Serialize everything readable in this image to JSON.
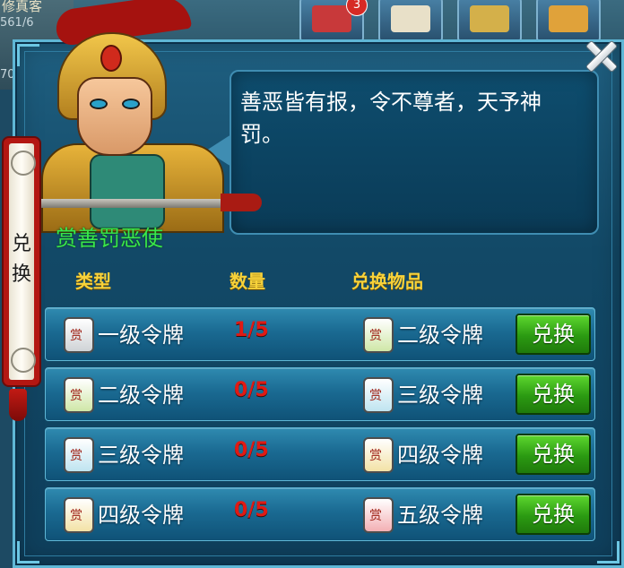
{
  "background": {
    "left_text_top": "修真客",
    "left_text_stat": "561/6",
    "left_text_num": "70",
    "badge_count": "3",
    "icon_labels": [
      "提升",
      "邮件",
      "",
      ""
    ]
  },
  "dialog": {
    "side_tab_label": [
      "兑",
      "换"
    ],
    "npc_name": "赏善罚恶使",
    "speech": "善恶皆有报，令不尊者，天予神罚。",
    "colors": {
      "name": "#39e84a",
      "header": "#f7d23a",
      "qty": "#e01a14",
      "button": "#2b9a12"
    }
  },
  "table": {
    "headers": {
      "type": "类型",
      "qty": "数量",
      "reward": "兑换物品"
    },
    "rows": [
      {
        "item": "一级令牌",
        "qty": "1/5",
        "reward": "二级令牌",
        "button": "兑换",
        "item_color": "#cfd3d6",
        "reward_color": "#cfe7a7"
      },
      {
        "item": "二级令牌",
        "qty": "0/5",
        "reward": "三级令牌",
        "button": "兑换",
        "item_color": "#cfe7a7",
        "reward_color": "#bfe4f0"
      },
      {
        "item": "三级令牌",
        "qty": "0/5",
        "reward": "四级令牌",
        "button": "兑换",
        "item_color": "#bfe4f0",
        "reward_color": "#f3e2a6"
      },
      {
        "item": "四级令牌",
        "qty": "0/5",
        "reward": "五级令牌",
        "button": "兑换",
        "item_color": "#f3e2a6",
        "reward_color": "#f3b0b4"
      }
    ]
  },
  "background_icon": "close-icon"
}
